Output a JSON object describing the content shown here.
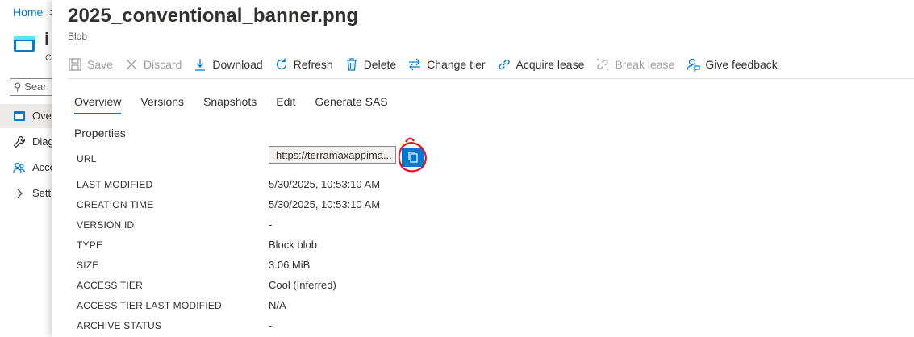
{
  "breadcrumb": {
    "home": "Home",
    "separator": ">"
  },
  "left_pane": {
    "resource_name_truncated": "i",
    "resource_subtitle_truncated": "C",
    "search_placeholder": "Sear",
    "nav": [
      {
        "label": "Ove",
        "icon": "overview-icon",
        "selected": true
      },
      {
        "label": "Diag",
        "icon": "wrench-icon",
        "selected": false
      },
      {
        "label": "Acce",
        "icon": "people-icon",
        "selected": false
      },
      {
        "label": "Setti",
        "icon": "chevron-right-icon",
        "selected": false
      }
    ]
  },
  "blade": {
    "title": "2025_conventional_banner.png",
    "subtitle": "Blob"
  },
  "toolbar": {
    "save": "Save",
    "discard": "Discard",
    "download": "Download",
    "refresh": "Refresh",
    "delete": "Delete",
    "change_tier": "Change tier",
    "acquire_lease": "Acquire lease",
    "break_lease": "Break lease",
    "give_feedback": "Give feedback"
  },
  "tabs": {
    "overview": "Overview",
    "versions": "Versions",
    "snapshots": "Snapshots",
    "edit": "Edit",
    "generate_sas": "Generate SAS"
  },
  "properties": {
    "heading": "Properties",
    "url_label": "URL",
    "url_value": "https://terramaxappima...",
    "last_modified_label": "LAST MODIFIED",
    "last_modified_value": "5/30/2025, 10:53:10 AM",
    "creation_time_label": "CREATION TIME",
    "creation_time_value": "5/30/2025, 10:53:10 AM",
    "version_id_label": "VERSION ID",
    "version_id_value": "-",
    "type_label": "TYPE",
    "type_value": "Block blob",
    "size_label": "SIZE",
    "size_value": "3.06 MiB",
    "access_tier_label": "ACCESS TIER",
    "access_tier_value": "Cool (Inferred)",
    "access_tier_last_modified_label": "ACCESS TIER LAST MODIFIED",
    "access_tier_last_modified_value": "N/A",
    "archive_status_label": "ARCHIVE STATUS",
    "archive_status_value": "-"
  },
  "colors": {
    "accent": "#0078d4",
    "annotation": "#e81123",
    "disabled": "#a19f9d"
  }
}
